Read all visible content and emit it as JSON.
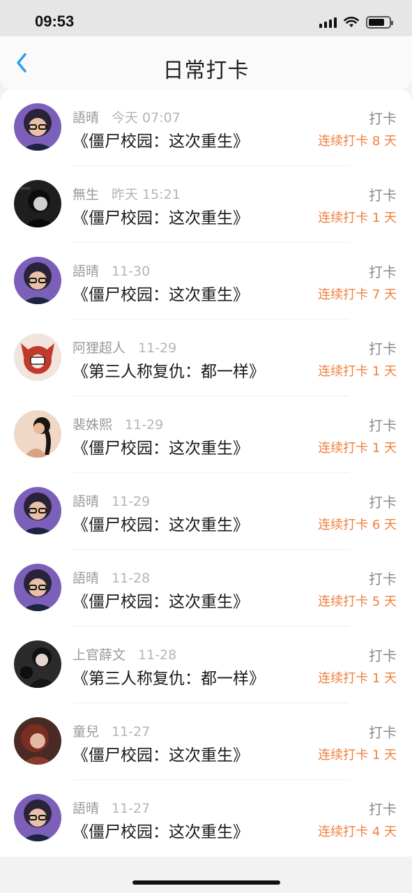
{
  "status_bar": {
    "time": "09:53"
  },
  "header": {
    "title": "日常打卡"
  },
  "items": [
    {
      "user": "語晴",
      "date": "今天 07:07",
      "title": "《僵尸校园：这次重生》",
      "action": "打卡",
      "streak": "连续打卡 8 天",
      "avatar": "woman-glasses-avatar"
    },
    {
      "user": "無生",
      "date": "昨天 15:21",
      "title": "《僵尸校园：这次重生》",
      "action": "打卡",
      "streak": "连续打卡 1 天",
      "avatar": "dark-hair-avatar"
    },
    {
      "user": "語晴",
      "date": "11-30",
      "title": "《僵尸校园：这次重生》",
      "action": "打卡",
      "streak": "连续打卡 7 天",
      "avatar": "woman-glasses-avatar"
    },
    {
      "user": "阿狸超人",
      "date": "11-29",
      "title": "《第三人称复仇：都一样》",
      "action": "打卡",
      "streak": "连续打卡 1 天",
      "avatar": "red-fox-avatar"
    },
    {
      "user": "裴姝熙",
      "date": "11-29",
      "title": "《僵尸校园：这次重生》",
      "action": "打卡",
      "streak": "连续打卡 1 天",
      "avatar": "woman-ponytail-avatar"
    },
    {
      "user": "語晴",
      "date": "11-29",
      "title": "《僵尸校园：这次重生》",
      "action": "打卡",
      "streak": "连续打卡 6 天",
      "avatar": "woman-glasses-avatar"
    },
    {
      "user": "語晴",
      "date": "11-28",
      "title": "《僵尸校园：这次重生》",
      "action": "打卡",
      "streak": "连续打卡 5 天",
      "avatar": "woman-glasses-avatar"
    },
    {
      "user": "上官薛文",
      "date": "11-28",
      "title": "《第三人称复仇：都一样》",
      "action": "打卡",
      "streak": "连续打卡 1 天",
      "avatar": "man-with-cat-avatar"
    },
    {
      "user": "童兒",
      "date": "11-27",
      "title": "《僵尸校园：这次重生》",
      "action": "打卡",
      "streak": "连续打卡 1 天",
      "avatar": "woman-red-hair-avatar"
    },
    {
      "user": "語晴",
      "date": "11-27",
      "title": "《僵尸校园：这次重生》",
      "action": "打卡",
      "streak": "连续打卡 4 天",
      "avatar": "woman-glasses-avatar"
    }
  ],
  "colors": {
    "accent": "#f07f3c",
    "back": "#2a9df4"
  }
}
